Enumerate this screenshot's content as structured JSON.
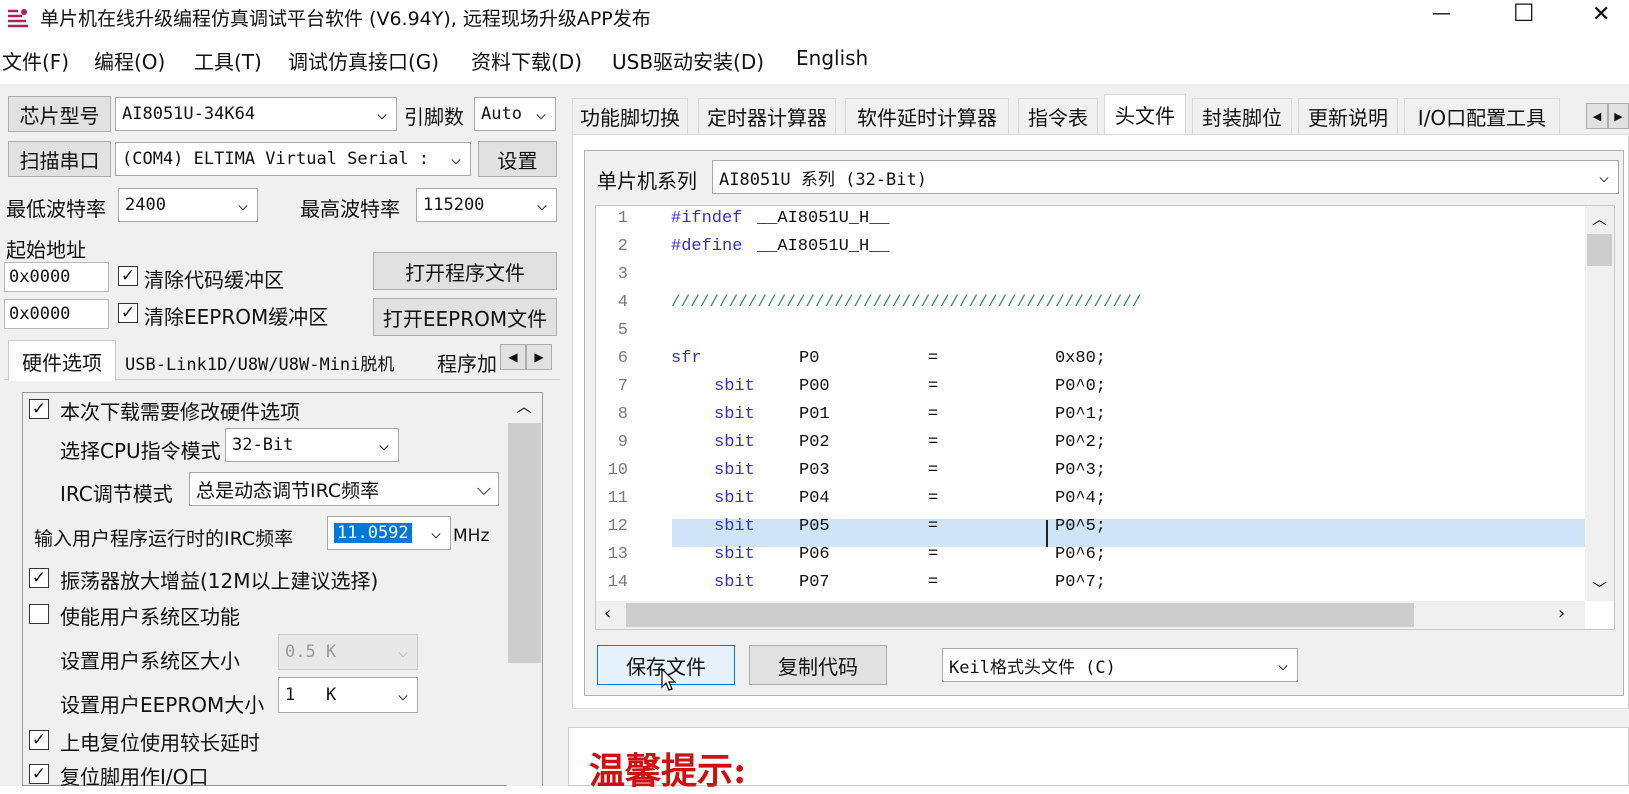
{
  "window": {
    "title": "单片机在线升级编程仿真调试平台软件 (V6.94Y), 远程现场升级APP发布",
    "minimize": "—",
    "maximize": "☐",
    "close": "✕"
  },
  "menu": [
    "文件(F)",
    "编程(O)",
    "工具(T)",
    "调试仿真接口(G)",
    "资料下载(D)",
    "USB驱动安装(D)",
    "English"
  ],
  "left": {
    "chip_btn": "芯片型号",
    "chip_value": "AI8051U-34K64",
    "pin_label": "引脚数",
    "pin_value": "Auto",
    "scan_btn": "扫描串口",
    "port_value": "(COM4) ELTIMA Virtual Serial :",
    "settings_btn": "设置",
    "min_baud_label": "最低波特率",
    "min_baud": "2400",
    "max_baud_label": "最高波特率",
    "max_baud": "115200",
    "start_addr_label": "起始地址",
    "addr1": "0x0000",
    "clear_code": "清除代码缓冲区",
    "open_prog_btn": "打开程序文件",
    "addr2": "0x0000",
    "clear_eeprom": "清除EEPROM缓冲区",
    "open_eeprom_btn": "打开EEPROM文件",
    "tabs": [
      "硬件选项",
      "USB-Link1D/U8W/U8W-Mini脱机",
      "程序加"
    ],
    "opt_modify": "本次下载需要修改硬件选项",
    "cpu_mode_label": "选择CPU指令模式",
    "cpu_mode": "32-Bit",
    "irc_mode_label": "IRC调节模式",
    "irc_mode": "总是动态调节IRC频率",
    "irc_freq_label": "输入用户程序运行时的IRC频率",
    "irc_freq": "11.0592",
    "irc_unit": "MHz",
    "osc_gain": "振荡器放大增益(12M以上建议选择)",
    "user_sys": "使能用户系统区功能",
    "sys_size_label": "设置用户系统区大小",
    "sys_size": "0.5 K",
    "eeprom_size_label": "设置用户EEPROM大小",
    "eeprom_size": "1   K",
    "long_delay": "上电复位使用较长延时",
    "reset_io": "复位脚用作I/O口"
  },
  "right": {
    "tabs": [
      "功能脚切换",
      "定时器计算器",
      "软件延时计算器",
      "指令表",
      "头文件",
      "封装脚位",
      "更新说明",
      "I/O口配置工具"
    ],
    "series_label": "单片机系列",
    "series_value": "AI8051U 系列 (32-Bit)",
    "code_lines": [
      {
        "n": "1",
        "a": "#ifndef",
        "b": "__AI8051U_H__",
        "c": "",
        "d": ""
      },
      {
        "n": "2",
        "a": "#define",
        "b": "__AI8051U_H__",
        "c": "",
        "d": ""
      },
      {
        "n": "3",
        "a": "",
        "b": "",
        "c": "",
        "d": ""
      },
      {
        "n": "4",
        "a": "/////////////////////////////////////////////////",
        "b": "",
        "c": "",
        "d": ""
      },
      {
        "n": "5",
        "a": "",
        "b": "",
        "c": "",
        "d": ""
      },
      {
        "n": "6",
        "a": "sfr",
        "b": "P0",
        "c": "=",
        "d": "0x80;"
      },
      {
        "n": "7",
        "a": "sbit",
        "b": "P00",
        "c": "=",
        "d": "P0^0;"
      },
      {
        "n": "8",
        "a": "sbit",
        "b": "P01",
        "c": "=",
        "d": "P0^1;"
      },
      {
        "n": "9",
        "a": "sbit",
        "b": "P02",
        "c": "=",
        "d": "P0^2;"
      },
      {
        "n": "10",
        "a": "sbit",
        "b": "P03",
        "c": "=",
        "d": "P0^3;"
      },
      {
        "n": "11",
        "a": "sbit",
        "b": "P04",
        "c": "=",
        "d": "P0^4;"
      },
      {
        "n": "12",
        "a": "sbit",
        "b": "P05",
        "c": "=",
        "d": "P0^5;"
      },
      {
        "n": "13",
        "a": "sbit",
        "b": "P06",
        "c": "=",
        "d": "P0^6;"
      },
      {
        "n": "14",
        "a": "sbit",
        "b": "P07",
        "c": "=",
        "d": "P0^7;"
      }
    ],
    "save_btn": "保存文件",
    "copy_btn": "复制代码",
    "format_value": "Keil格式头文件 (C)",
    "tip_title": "温馨提示:"
  }
}
